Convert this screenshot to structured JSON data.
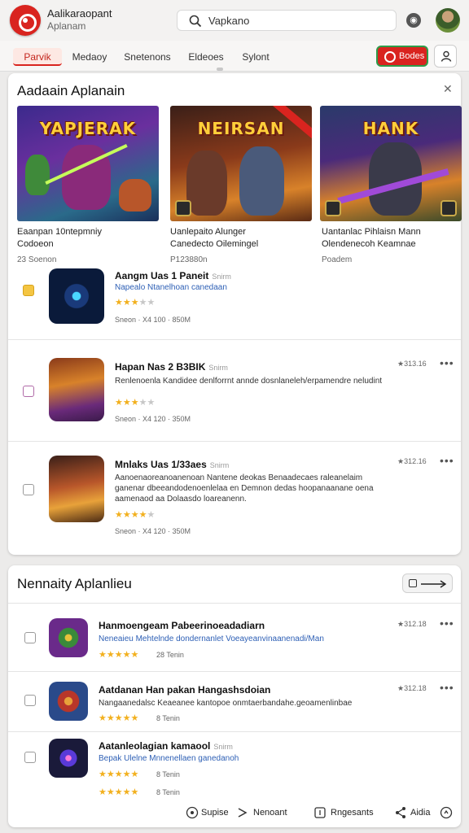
{
  "header": {
    "title": "Aalikaraopant",
    "subtitle": "Aplanam",
    "search_value": "Vapkano",
    "search_placeholder": "Search"
  },
  "tabs": [
    {
      "label": "Parvik",
      "active": true
    },
    {
      "label": "Medaoy",
      "active": false
    },
    {
      "label": "Snetenons",
      "active": false
    },
    {
      "label": "Eldeoes",
      "active": false
    },
    {
      "label": "Sylont",
      "active": false
    }
  ],
  "header_button": {
    "label": "Bodes"
  },
  "section1": {
    "title": "Aadaain Aplanain",
    "featured": [
      {
        "art": "YAPJERAK",
        "name_line1": "Eaanpan 10ntepmniy",
        "name_line2": "Codoeon",
        "meta": "23 Soenon"
      },
      {
        "art": "NEIRSAN",
        "name_line1": "Uanlepaito Alunger",
        "name_line2": "Canedecto Oilemingel",
        "meta": "P123880n"
      },
      {
        "art": "HANK",
        "name_line1": "Uantanlac Pihlaisn Mann",
        "name_line2": "Olendenecoh Keamnae",
        "meta": "Poadem"
      }
    ],
    "rows": [
      {
        "title": "Aangm Uas 1 Paneit",
        "tag": "Snirm",
        "link": "Napealo Ntanelhoan canedaan",
        "desc": "",
        "rating": 3,
        "foot": "Sneon  ·  X4 100 · 850M",
        "count": ""
      },
      {
        "title": "Hapan Nas 2 B3BIK",
        "tag": "Snirm",
        "link": "",
        "desc": "Renlenoenla Kandidee denlforrnt annde dosnlaneleh/erpamendre neludint",
        "rating": 3,
        "foot": "Sneon  ·  X4 120 · 350M",
        "count": "★313.16"
      },
      {
        "title": "Mnlaks Uas 1/33aes",
        "tag": "Snirm",
        "link": "",
        "desc": "Aanoenaoreanoanenoan Nantene deokas Benaadecaes raleanelaim ganenar dbeeandodenoenlelaa en Demnon dedas hoopanaanane oena aamenaod aa Dolaasdo loareanenn.",
        "rating": 4,
        "foot": "Sneon  ·  X4 120 · 350M",
        "count": "★312.16"
      }
    ]
  },
  "section2": {
    "title": "Nennaity Aplanlieu",
    "rows": [
      {
        "title": "Hanmoengeam Pabeerinoeadadiarn",
        "link": "Neneaieu Mehtelnde dondernanlet Voeayeanvinaanenadi/Man",
        "desc": "",
        "rating": 5,
        "foot": "28  Tenin",
        "count": "★312.18"
      },
      {
        "title": "Aatdanan Han pakan Hangashsdoian",
        "link": "",
        "desc": "Nangaanedalsc Keaeanee kantopoe onmtaerbandahe.geoamenlinbae",
        "rating": 5,
        "foot": "8  Tenin",
        "count": "★312.18"
      },
      {
        "title": "Aatanleolagian kamaool",
        "tag": "Snirm",
        "link": "Bepak Ulelne Mnnenellaen ganedanoh",
        "desc": "",
        "rating": 5,
        "foot": "8  Tenin",
        "count": ""
      }
    ],
    "last_foot": "8  Tenin"
  },
  "bottom_nav": [
    {
      "label": "Supise",
      "icon": "help-circle-icon"
    },
    {
      "label": "Nenoant",
      "icon": "share-arrow-icon"
    },
    {
      "label": "Rngesants",
      "icon": "box-icon"
    },
    {
      "label": "Aidia",
      "icon": "share-icon"
    },
    {
      "label": "",
      "icon": "chat-icon"
    }
  ],
  "colors": {
    "accent": "#d9241f",
    "link": "#2d5fb5",
    "star": "#f2b01e"
  }
}
